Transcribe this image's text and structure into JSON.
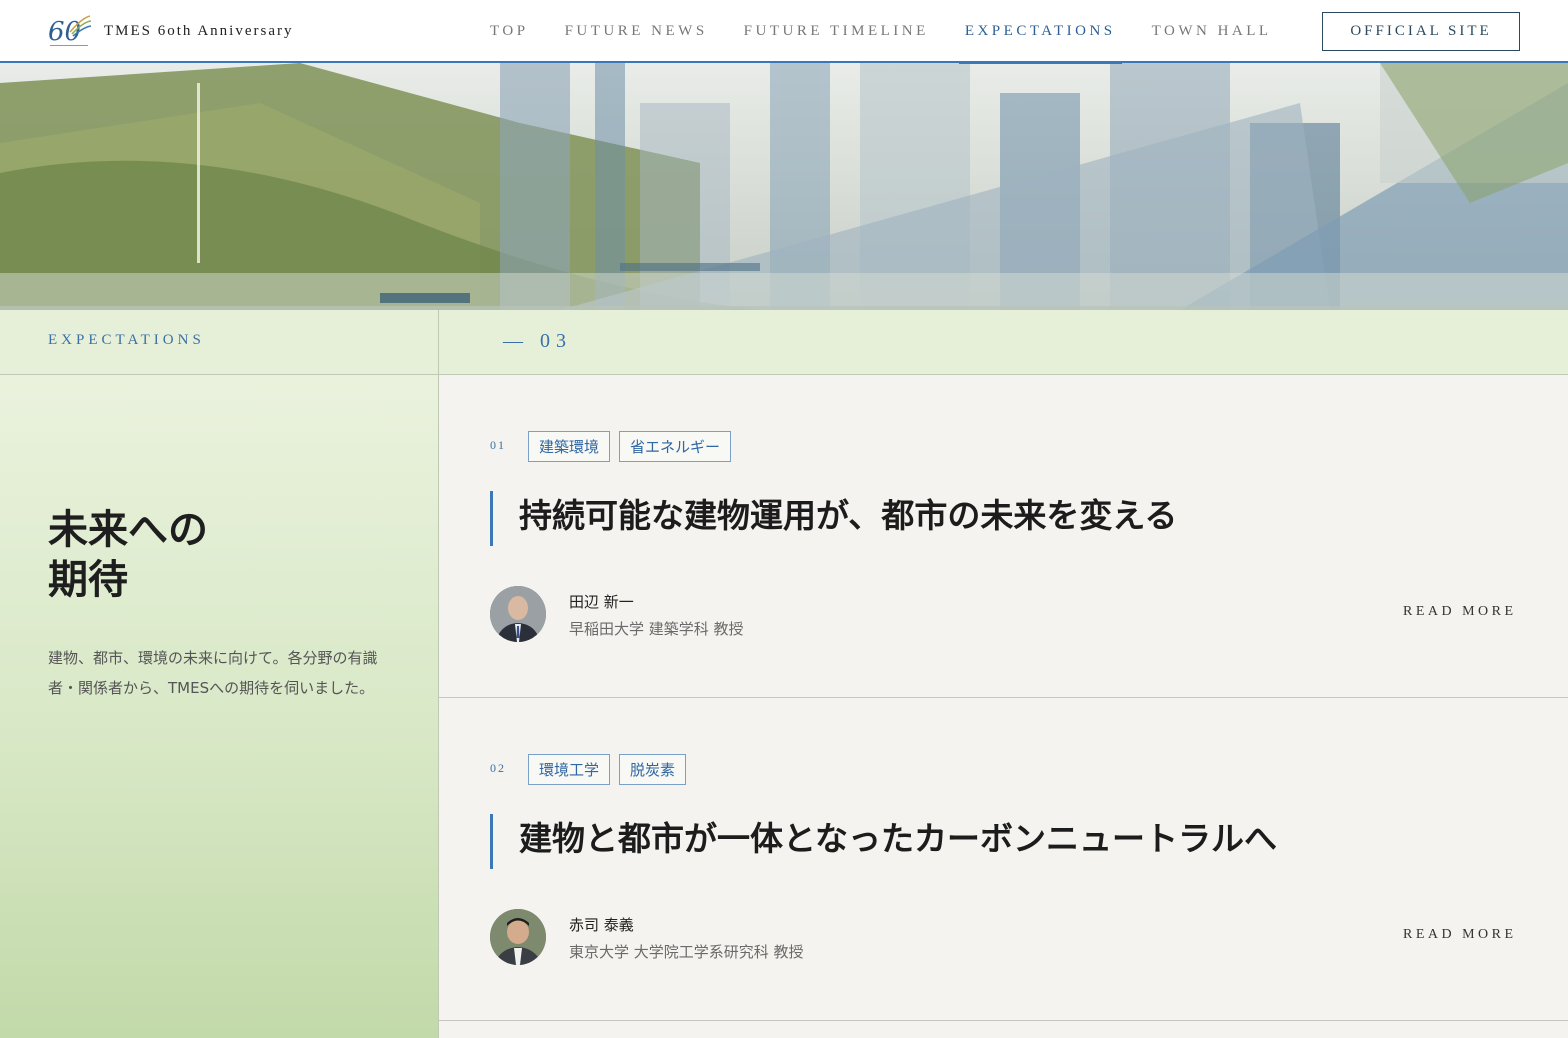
{
  "header": {
    "logo_title": "TMES 6oth Anniversary",
    "nav": [
      {
        "label": "TOP"
      },
      {
        "label": "FUTURE NEWS"
      },
      {
        "label": "FUTURE TIMELINE"
      },
      {
        "label": "EXPECTATIONS",
        "active": true
      },
      {
        "label": "TOWN HALL"
      }
    ],
    "official_site": "OFFICIAL SITE"
  },
  "band": {
    "label": "EXPECTATIONS",
    "count": "— 03"
  },
  "sidebar": {
    "title_line1": "未来への",
    "title_line2": "期待",
    "description": "建物、都市、環境の未来に向けて。各分野の有識者・関係者から、TMESへの期待を伺いました。"
  },
  "articles": [
    {
      "number": "01",
      "tags": [
        "建築環境",
        "省エネルギー"
      ],
      "title": "持続可能な建物運用が、都市の未来を変える",
      "author_name": "田辺 新一",
      "author_affiliation": "早稲田大学 建築学科 教授",
      "read_more": "READ MORE"
    },
    {
      "number": "02",
      "tags": [
        "環境工学",
        "脱炭素"
      ],
      "title": "建物と都市が一体となったカーボンニュートラルへ",
      "author_name": "赤司 泰義",
      "author_affiliation": "東京大学 大学院工学系研究科 教授",
      "read_more": "READ MORE"
    }
  ],
  "colors": {
    "accent_blue": "#3a78b8",
    "band_green": "#e6f0d8",
    "background": "#f4f3ef"
  }
}
